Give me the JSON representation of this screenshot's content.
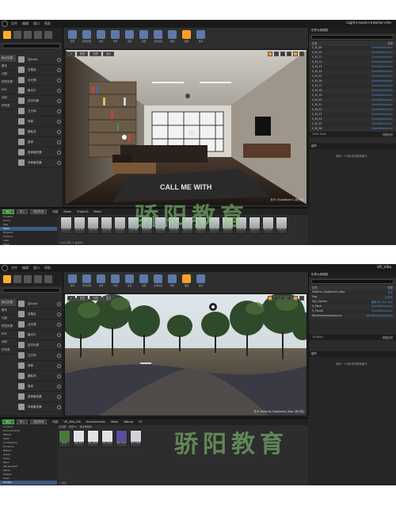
{
  "shot1": {
    "menu": [
      "文件",
      "编辑",
      "窗口",
      "帮助"
    ],
    "tab_title": "Light+room+interior+tm",
    "modes_search": "",
    "categories": [
      "最近放置",
      "基本",
      "光照",
      "视觉效果",
      "BSP",
      "体积",
      "所有类"
    ],
    "placeables": [
      "空Actor",
      "空角色",
      "点光源",
      "聚光灯",
      "定向光源",
      "立方体",
      "球体",
      "圆柱体",
      "锥体",
      "盒体触发器",
      "球体触发器"
    ],
    "toolbar": [
      "保存",
      "源码管理",
      "内容",
      "市场",
      "设置",
      "蓝图",
      "过场动画",
      "构建",
      "播放",
      "启动"
    ],
    "viewport": {
      "buttons": [
        "透视",
        "光照",
        "显示"
      ],
      "caption": "关卡: ShowRoom1 (永久性)",
      "overlay_text": "CALL ME WITH"
    },
    "outliner": {
      "header": "世界大纲视图",
      "col_label": "标签",
      "col_type": "类型",
      "rows": [
        {
          "label": "S_M_09",
          "type": "StaticMeshActor"
        },
        {
          "label": "S_M_10",
          "type": "StaticMeshActor"
        },
        {
          "label": "S_M_11",
          "type": "StaticMeshActor"
        },
        {
          "label": "S_M_12",
          "type": "StaticMeshActor"
        },
        {
          "label": "S_M_13",
          "type": "StaticMeshActor"
        },
        {
          "label": "S_M_14",
          "type": "StaticMeshActor"
        },
        {
          "label": "S_M_15",
          "type": "StaticMeshActor"
        },
        {
          "label": "S_M_16",
          "type": "StaticMeshActor"
        },
        {
          "label": "S_M_17",
          "type": "StaticMeshActor"
        },
        {
          "label": "S_M_18",
          "type": "StaticMeshActor"
        },
        {
          "label": "S_M_19",
          "type": "StaticMeshActor"
        },
        {
          "label": "S_M_20",
          "type": "StaticMeshActor"
        },
        {
          "label": "S_M_21",
          "type": "StaticMeshActor"
        },
        {
          "label": "S_M_22",
          "type": "StaticMeshActor"
        },
        {
          "label": "S_M_23",
          "type": "StaticMeshActor"
        },
        {
          "label": "S_M_24",
          "type": "StaticMeshActor"
        },
        {
          "label": "S_M_25",
          "type": "StaticMeshActor"
        },
        {
          "label": "S_M_26",
          "type": "StaticMeshActor"
        }
      ],
      "count": "1444 Actor",
      "view_options": "视图选项"
    },
    "details": {
      "header": "细节",
      "hint": "选择一个对象来查看其细节。"
    },
    "content_browser": {
      "add": "添加",
      "import": "导入",
      "save_all": "保存所有",
      "crumbs": [
        "内容",
        "Room",
        "Project2",
        "Mesh"
      ],
      "tree": [
        "Content",
        "Room",
        "Map",
        "Mesh",
        "Project2",
        "Camera",
        "Light",
        "Mesh",
        "Textures",
        "Props",
        "Materials",
        "VR_Villa_File"
      ],
      "asset_names": [
        "S_M_01",
        "S_M_02",
        "S_M_03",
        "S_M_04",
        "S_M_05",
        "S_M_06",
        "S_M_07",
        "S_M_08",
        "S_M_09",
        "S_M_10",
        "S_M_11",
        "S_M_12",
        "S_M_13",
        "S_M_14",
        "S_M_15",
        "S_M_16",
        "S_M_17"
      ],
      "footer": "1440 项目 (1 被选中)"
    }
  },
  "shot2": {
    "menu": [
      "文件",
      "编辑",
      "窗口",
      "帮助"
    ],
    "tab_title": "VR_Villa",
    "categories": [
      "最近放置",
      "基本",
      "光照",
      "视觉效果",
      "BSP",
      "体积",
      "所有类"
    ],
    "placeables": [
      "空Actor",
      "空角色",
      "点光源",
      "聚光灯",
      "定向光源",
      "立方体",
      "球体",
      "圆柱体",
      "锥体",
      "盒体触发器",
      "球体触发器"
    ],
    "toolbar": [
      "保存",
      "源码管理",
      "内容",
      "市场",
      "设置",
      "蓝图",
      "过场动画",
      "构建",
      "播放",
      "启动"
    ],
    "viewport": {
      "buttons": [
        "透视",
        "光照",
        "显示"
      ],
      "caption": "关卡: Material_Vegetation_Map (永久性)"
    },
    "outliner": {
      "header": "世界大纲视图",
      "col_label": "标签",
      "col_type": "类型",
      "rows": [
        {
          "label": "Material_Vegetation_Map",
          "type": "世界"
        },
        {
          "label": "Fog",
          "type": "文件夹"
        },
        {
          "label": "Sky_Sphere",
          "type": "编辑 BP_Sky_Sph"
        },
        {
          "label": "S_Plant",
          "type": "StaticMeshActor"
        },
        {
          "label": "S_Planet",
          "type": "StaticMeshActor"
        },
        {
          "label": "WindDirectionalSource",
          "type": "WindDirectionalSour"
        }
      ],
      "count": "19 Actor",
      "view_options": "视图选项"
    },
    "details": {
      "header": "细节",
      "hint": "选择一个对象来查看其细节。"
    },
    "content_browser": {
      "add": "添加",
      "import": "导入",
      "save_all": "保存所有",
      "crumbs": [
        "内容",
        "VR_Villa_File",
        "Environments",
        "Mesh",
        "Nature",
        "ST"
      ],
      "filters": [
        "过滤器",
        "搜索ST",
        "静态网格体"
      ],
      "tree": [
        "Content",
        "Environments",
        "Effects",
        "Mesh",
        "Architecture",
        "Furniture",
        "Nature",
        "Grass",
        "Rocks",
        "Plant",
        "SM_PoolSQT",
        "Plants",
        "Models",
        "Trees",
        "Shrubs",
        "Lib_Background",
        "Trees",
        "Effects",
        "Materials"
      ],
      "asset_names": [
        "Bush",
        "SM_Tree",
        "SM_Tree2",
        "SM_Tree3",
        "SM_Tree4",
        "SM_Tree5"
      ],
      "footer": "6 项目"
    }
  },
  "watermark": "骄阳教育",
  "colors": {
    "accent": "#ff9f2a",
    "panel": "#262626",
    "selection": "#3b5a80",
    "toolbar_icon": "#5c7aa8"
  }
}
